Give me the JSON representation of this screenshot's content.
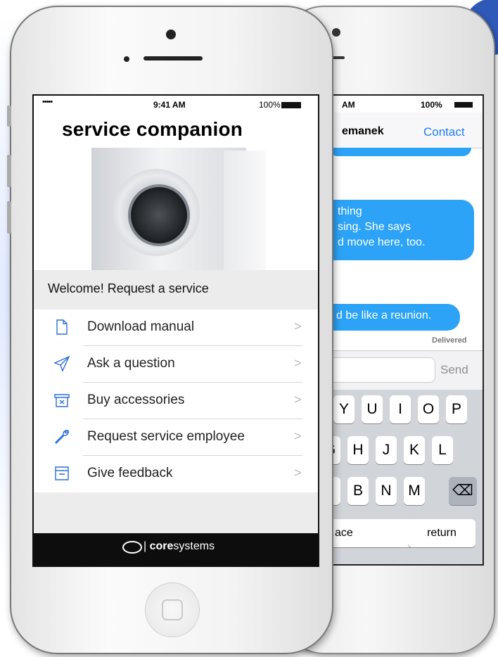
{
  "front_phone": {
    "status": {
      "signal": "•••••",
      "time": "9:41 AM",
      "battery": "100%"
    },
    "app_title": "service companion",
    "welcome": "Welcome! Request a service",
    "menu": [
      {
        "label": "Download manual",
        "icon": "document-icon"
      },
      {
        "label": "Ask a question",
        "icon": "paper-plane-icon"
      },
      {
        "label": "Buy accessories",
        "icon": "box-icon"
      },
      {
        "label": "Request service employee",
        "icon": "wrench-icon"
      },
      {
        "label": "Give feedback",
        "icon": "archive-icon"
      }
    ],
    "chevron": ">",
    "footer": {
      "brand_bold": "core",
      "brand_rest": "systems"
    }
  },
  "back_phone": {
    "status": {
      "time": "AM",
      "battery": "100%"
    },
    "contact_name": "emanek",
    "contact_button": "Contact",
    "message1_lines": [
      "thing",
      "sing. She says",
      "d move here, too."
    ],
    "message2": "d be like a reunion.",
    "delivered": "Delivered",
    "send": "Send",
    "keys_row1": [
      "Y",
      "U",
      "I",
      "O",
      "P"
    ],
    "keys_row2": [
      "G",
      "H",
      "J",
      "K",
      "L"
    ],
    "keys_row3": [
      "/",
      "B",
      "N",
      "M"
    ],
    "delete_key": "⌫",
    "space_key": "ace",
    "return_key": "return"
  },
  "colors": {
    "accent_blue": "#2f59b8",
    "bubble": "#2ca3f7",
    "ios_link": "#1f7ef0"
  }
}
